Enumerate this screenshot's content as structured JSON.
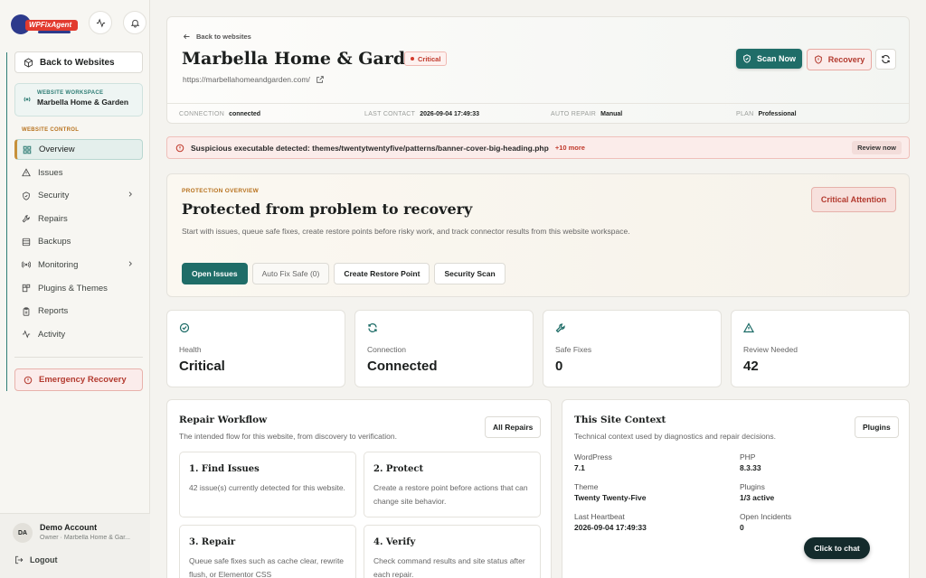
{
  "sidebar": {
    "back_label": "Back to Websites",
    "workspace_caption": "WEBSITE WORKSPACE",
    "workspace_name": "Marbella Home & Garden",
    "section_caption": "WEBSITE CONTROL",
    "items": [
      {
        "label": "Overview",
        "icon": "grid-icon"
      },
      {
        "label": "Issues",
        "icon": "warning-icon"
      },
      {
        "label": "Security",
        "icon": "shield-icon"
      },
      {
        "label": "Repairs",
        "icon": "wrench-icon"
      },
      {
        "label": "Backups",
        "icon": "database-icon"
      },
      {
        "label": "Monitoring",
        "icon": "signal-icon"
      },
      {
        "label": "Plugins & Themes",
        "icon": "plugin-icon"
      },
      {
        "label": "Reports",
        "icon": "clipboard-icon"
      },
      {
        "label": "Activity",
        "icon": "activity-icon"
      }
    ],
    "emergency_label": "Emergency Recovery",
    "account": {
      "initials": "DA",
      "name": "Demo Account",
      "subtitle": "Owner · Marbella Home & Gar..."
    },
    "logout_label": "Logout"
  },
  "header": {
    "back_link": "Back to websites",
    "title": "Marbella Home & Garden",
    "status_badge": "Critical",
    "url": "https://marbellahomeandgarden.com/",
    "scan_label": "Scan Now",
    "recovery_label": "Recovery",
    "meta": [
      {
        "key": "CONNECTION",
        "value": "connected"
      },
      {
        "key": "LAST CONTACT",
        "value": "2026-09-04 17:49:33"
      },
      {
        "key": "AUTO REPAIR",
        "value": "Manual"
      },
      {
        "key": "PLAN",
        "value": "Professional"
      }
    ]
  },
  "alert": {
    "text": "Suspicious executable detected: themes/twentytwentyfive/patterns/banner-cover-big-heading.php",
    "more": "+10 more",
    "action": "Review now"
  },
  "protection": {
    "caption": "PROTECTION OVERVIEW",
    "title": "Protected from problem to recovery",
    "description": "Start with issues, queue safe fixes, create restore points before risky work, and track connector results from this website workspace.",
    "attention_label": "Critical Attention",
    "buttons": [
      "Open Issues",
      "Auto Fix Safe (0)",
      "Create Restore Point",
      "Security Scan"
    ]
  },
  "stats": [
    {
      "label": "Health",
      "value": "Critical",
      "icon": "check-circle-icon"
    },
    {
      "label": "Connection",
      "value": "Connected",
      "icon": "refresh-icon"
    },
    {
      "label": "Safe Fixes",
      "value": "0",
      "icon": "wrench-icon"
    },
    {
      "label": "Review Needed",
      "value": "42",
      "icon": "warning-icon"
    }
  ],
  "workflow": {
    "title": "Repair Workflow",
    "subtitle": "The intended flow for this website, from discovery to verification.",
    "button": "All Repairs",
    "steps": [
      {
        "title": "1. Find Issues",
        "desc": "42 issue(s) currently detected for this website."
      },
      {
        "title": "2. Protect",
        "desc": "Create a restore point before actions that can change site behavior."
      },
      {
        "title": "3. Repair",
        "desc": "Queue safe fixes such as cache clear, rewrite flush, or Elementor CSS"
      },
      {
        "title": "4. Verify",
        "desc": "Check command results and site status after each repair."
      }
    ]
  },
  "context": {
    "title": "This Site Context",
    "subtitle": "Technical context used by diagnostics and repair decisions.",
    "button": "Plugins",
    "items": [
      {
        "key": "WordPress",
        "value": "7.1"
      },
      {
        "key": "PHP",
        "value": "8.3.33"
      },
      {
        "key": "Theme",
        "value": "Twenty Twenty-Five"
      },
      {
        "key": "Plugins",
        "value": "1/3 active"
      },
      {
        "key": "Last Heartbeat",
        "value": "2026-09-04 17:49:33"
      },
      {
        "key": "Open Incidents",
        "value": "0"
      }
    ]
  },
  "chat_label": "Click to chat",
  "logo_text": "WPFixAgent",
  "colors": {
    "accent": "#1f6d68",
    "danger": "#c0392b",
    "caption": "#b8731f"
  }
}
